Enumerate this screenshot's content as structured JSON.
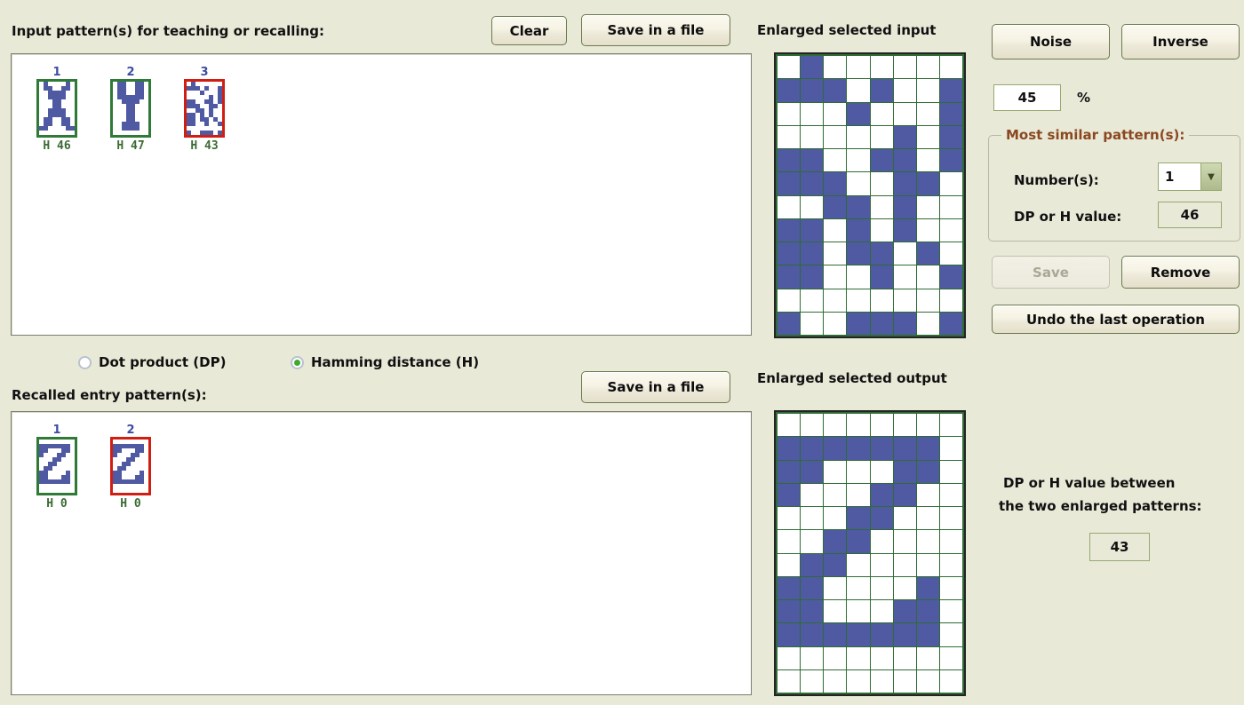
{
  "colors": {
    "background": "#e9e9d8",
    "pattern_on": "#4f5aa3",
    "pattern_off": "#ffffff",
    "grid_line": "#2f6b34",
    "thumb_border_normal": "#2f7a36",
    "thumb_border_selected": "#d01f12",
    "group_title": "#8a4820",
    "index_label": "#3b4da0",
    "caption": "#3b6b33"
  },
  "input_section": {
    "title": "Input pattern(s) for teaching or recalling:",
    "clear_button": "Clear",
    "save_button": "Save in a file",
    "patterns": [
      {
        "index": "1",
        "caption": "H 46",
        "selected": false,
        "bits": [
          [
            0,
            1,
            0,
            0,
            0,
            0,
            1,
            0
          ],
          [
            0,
            1,
            1,
            0,
            0,
            1,
            1,
            0
          ],
          [
            0,
            0,
            1,
            1,
            1,
            1,
            0,
            0
          ],
          [
            0,
            0,
            1,
            1,
            1,
            1,
            0,
            0
          ],
          [
            0,
            0,
            0,
            1,
            1,
            0,
            0,
            0
          ],
          [
            0,
            0,
            0,
            1,
            1,
            0,
            0,
            0
          ],
          [
            0,
            0,
            1,
            1,
            1,
            1,
            0,
            0
          ],
          [
            0,
            0,
            1,
            1,
            1,
            1,
            0,
            0
          ],
          [
            0,
            1,
            1,
            0,
            0,
            1,
            1,
            0
          ],
          [
            0,
            1,
            1,
            0,
            0,
            1,
            1,
            0
          ],
          [
            1,
            1,
            0,
            0,
            0,
            0,
            1,
            1
          ],
          [
            0,
            0,
            0,
            0,
            0,
            0,
            0,
            0
          ]
        ]
      },
      {
        "index": "2",
        "caption": "H 47",
        "selected": false,
        "bits": [
          [
            0,
            1,
            1,
            0,
            0,
            1,
            1,
            0
          ],
          [
            0,
            1,
            1,
            0,
            0,
            1,
            1,
            0
          ],
          [
            0,
            1,
            1,
            0,
            0,
            1,
            1,
            0
          ],
          [
            0,
            1,
            1,
            1,
            1,
            1,
            1,
            0
          ],
          [
            0,
            0,
            1,
            1,
            1,
            1,
            0,
            0
          ],
          [
            0,
            0,
            0,
            1,
            1,
            0,
            0,
            0
          ],
          [
            0,
            0,
            0,
            1,
            1,
            0,
            0,
            0
          ],
          [
            0,
            0,
            0,
            1,
            1,
            0,
            0,
            0
          ],
          [
            0,
            0,
            0,
            1,
            1,
            0,
            0,
            0
          ],
          [
            0,
            0,
            1,
            1,
            1,
            1,
            0,
            0
          ],
          [
            0,
            0,
            1,
            1,
            1,
            1,
            0,
            0
          ],
          [
            0,
            0,
            0,
            0,
            0,
            0,
            0,
            0
          ]
        ]
      },
      {
        "index": "3",
        "caption": "H 43",
        "selected": true,
        "bits": [
          [
            0,
            1,
            0,
            0,
            0,
            0,
            0,
            0
          ],
          [
            1,
            1,
            1,
            0,
            1,
            0,
            0,
            1
          ],
          [
            0,
            0,
            0,
            1,
            0,
            0,
            0,
            1
          ],
          [
            0,
            0,
            0,
            0,
            0,
            1,
            0,
            1
          ],
          [
            1,
            1,
            0,
            0,
            1,
            1,
            0,
            1
          ],
          [
            1,
            1,
            1,
            0,
            0,
            1,
            1,
            0
          ],
          [
            0,
            0,
            1,
            1,
            0,
            1,
            0,
            0
          ],
          [
            1,
            1,
            0,
            1,
            0,
            1,
            0,
            0
          ],
          [
            1,
            1,
            0,
            1,
            1,
            0,
            1,
            0
          ],
          [
            1,
            1,
            0,
            0,
            1,
            0,
            0,
            1
          ],
          [
            0,
            0,
            0,
            0,
            0,
            0,
            0,
            0
          ],
          [
            1,
            0,
            0,
            1,
            1,
            1,
            0,
            1
          ]
        ]
      }
    ]
  },
  "metric_radios": {
    "dot_product": {
      "label": "Dot product (DP)",
      "checked": false
    },
    "hamming": {
      "label": "Hamming distance (H)",
      "checked": true
    }
  },
  "output_section": {
    "title": "Recalled entry pattern(s):",
    "save_button": "Save in a file",
    "patterns": [
      {
        "index": "1",
        "caption": "H 0",
        "selected": false,
        "bits": [
          [
            0,
            0,
            0,
            0,
            0,
            0,
            0,
            0
          ],
          [
            1,
            1,
            1,
            1,
            1,
            1,
            1,
            0
          ],
          [
            1,
            1,
            0,
            0,
            0,
            1,
            1,
            0
          ],
          [
            1,
            0,
            0,
            0,
            1,
            1,
            0,
            0
          ],
          [
            0,
            0,
            0,
            1,
            1,
            0,
            0,
            0
          ],
          [
            0,
            0,
            1,
            1,
            0,
            0,
            0,
            0
          ],
          [
            0,
            1,
            1,
            0,
            0,
            0,
            0,
            0
          ],
          [
            1,
            1,
            0,
            0,
            0,
            0,
            1,
            0
          ],
          [
            1,
            1,
            0,
            0,
            0,
            1,
            1,
            0
          ],
          [
            1,
            1,
            1,
            1,
            1,
            1,
            1,
            0
          ],
          [
            0,
            0,
            0,
            0,
            0,
            0,
            0,
            0
          ],
          [
            0,
            0,
            0,
            0,
            0,
            0,
            0,
            0
          ]
        ]
      },
      {
        "index": "2",
        "caption": "H 0",
        "selected": true,
        "bits": [
          [
            0,
            0,
            0,
            0,
            0,
            0,
            0,
            0
          ],
          [
            1,
            1,
            1,
            1,
            1,
            1,
            1,
            0
          ],
          [
            1,
            1,
            0,
            0,
            0,
            1,
            1,
            0
          ],
          [
            1,
            0,
            0,
            0,
            1,
            1,
            0,
            0
          ],
          [
            0,
            0,
            0,
            1,
            1,
            0,
            0,
            0
          ],
          [
            0,
            0,
            1,
            1,
            0,
            0,
            0,
            0
          ],
          [
            0,
            1,
            1,
            0,
            0,
            0,
            0,
            0
          ],
          [
            1,
            1,
            0,
            0,
            0,
            0,
            1,
            0
          ],
          [
            1,
            1,
            0,
            0,
            0,
            1,
            1,
            0
          ],
          [
            1,
            1,
            1,
            1,
            1,
            1,
            1,
            0
          ],
          [
            0,
            0,
            0,
            0,
            0,
            0,
            0,
            0
          ],
          [
            0,
            0,
            0,
            0,
            0,
            0,
            0,
            0
          ]
        ]
      }
    ]
  },
  "enlarged_input": {
    "title": "Enlarged selected input",
    "rows": 12,
    "cols": 8,
    "bits": [
      [
        0,
        1,
        0,
        0,
        0,
        0,
        0,
        0
      ],
      [
        1,
        1,
        1,
        0,
        1,
        0,
        0,
        1
      ],
      [
        0,
        0,
        0,
        1,
        0,
        0,
        0,
        1
      ],
      [
        0,
        0,
        0,
        0,
        0,
        1,
        0,
        1
      ],
      [
        1,
        1,
        0,
        0,
        1,
        1,
        0,
        1
      ],
      [
        1,
        1,
        1,
        0,
        0,
        1,
        1,
        0
      ],
      [
        0,
        0,
        1,
        1,
        0,
        1,
        0,
        0
      ],
      [
        1,
        1,
        0,
        1,
        0,
        1,
        0,
        0
      ],
      [
        1,
        1,
        0,
        1,
        1,
        0,
        1,
        0
      ],
      [
        1,
        1,
        0,
        0,
        1,
        0,
        0,
        1
      ],
      [
        0,
        0,
        0,
        0,
        0,
        0,
        0,
        0
      ],
      [
        1,
        0,
        0,
        1,
        1,
        1,
        0,
        1
      ]
    ]
  },
  "enlarged_output": {
    "title": "Enlarged selected output",
    "rows": 12,
    "cols": 8,
    "bits": [
      [
        0,
        0,
        0,
        0,
        0,
        0,
        0,
        0
      ],
      [
        1,
        1,
        1,
        1,
        1,
        1,
        1,
        0
      ],
      [
        1,
        1,
        0,
        0,
        0,
        1,
        1,
        0
      ],
      [
        1,
        0,
        0,
        0,
        1,
        1,
        0,
        0
      ],
      [
        0,
        0,
        0,
        1,
        1,
        0,
        0,
        0
      ],
      [
        0,
        0,
        1,
        1,
        0,
        0,
        0,
        0
      ],
      [
        0,
        1,
        1,
        0,
        0,
        0,
        0,
        0
      ],
      [
        1,
        1,
        0,
        0,
        0,
        0,
        1,
        0
      ],
      [
        1,
        1,
        0,
        0,
        0,
        1,
        1,
        0
      ],
      [
        1,
        1,
        1,
        1,
        1,
        1,
        1,
        0
      ],
      [
        0,
        0,
        0,
        0,
        0,
        0,
        0,
        0
      ],
      [
        0,
        0,
        0,
        0,
        0,
        0,
        0,
        0
      ]
    ]
  },
  "controls": {
    "noise_button": "Noise",
    "inverse_button": "Inverse",
    "noise_value": "45",
    "percent_label": "%",
    "most_similar": {
      "title": "Most similar pattern(s):",
      "numbers_label": "Number(s):",
      "numbers_value": "1",
      "dp_or_h_label": "DP or H value:",
      "dp_or_h_value": "46"
    },
    "save_button": "Save",
    "save_disabled": true,
    "remove_button": "Remove",
    "undo_button": "Undo the last operation"
  },
  "comparison": {
    "label_line1": "DP or H value between",
    "label_line2": "the two enlarged patterns:",
    "value": "43"
  }
}
